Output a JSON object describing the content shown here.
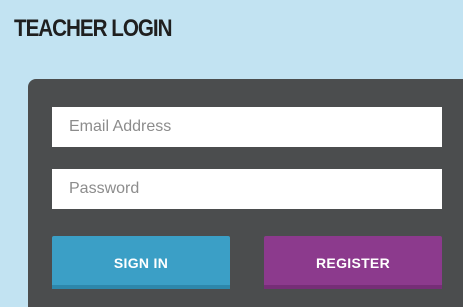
{
  "login": {
    "title": "TEACHER LOGIN",
    "email_placeholder": "Email Address",
    "password_placeholder": "Password",
    "signin_label": "SIGN IN",
    "register_label": "REGISTER"
  },
  "colors": {
    "panel_background": "#c2e3f2",
    "card_background": "#4b4d4e",
    "signin_button": "#3b9fc6",
    "register_button": "#8c3a8d"
  }
}
